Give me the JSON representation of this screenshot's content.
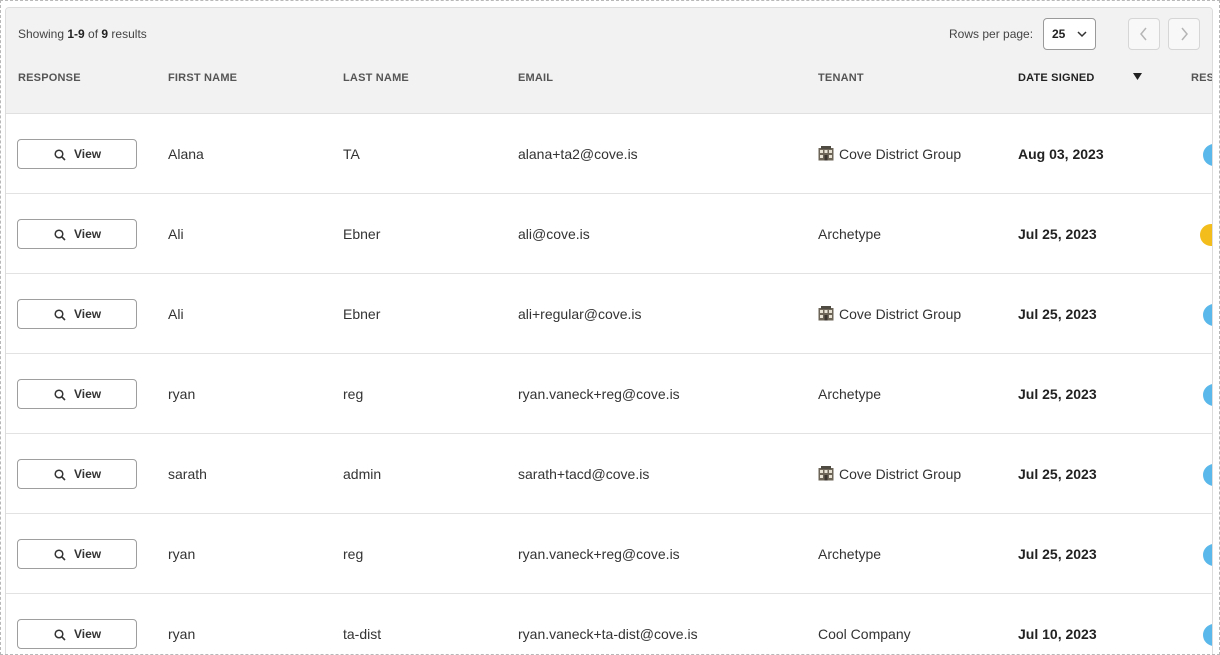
{
  "summary": {
    "prefix": "Showing ",
    "range": "1-9",
    "of_word": " of ",
    "total": "9",
    "suffix": " results"
  },
  "pagination": {
    "rows_per_page_label": "Rows per page:",
    "rows_per_page_value": "25"
  },
  "columns": {
    "response": "RESPONSE",
    "first_name": "FIRST NAME",
    "last_name": "LAST NAME",
    "email": "EMAIL",
    "tenant": "TENANT",
    "date_signed": "DATE SIGNED",
    "result_partial": "RES"
  },
  "view_label": "View",
  "rows": [
    {
      "first": "Alana",
      "last": "TA",
      "email": "alana+ta2@cove.is",
      "tenant": "Cove District Group",
      "tenant_icon": true,
      "date": "Aug 03, 2023",
      "status": "blue"
    },
    {
      "first": "Ali",
      "last": "Ebner",
      "email": "ali@cove.is",
      "tenant": "Archetype",
      "tenant_icon": false,
      "date": "Jul 25, 2023",
      "status": "yellow"
    },
    {
      "first": "Ali",
      "last": "Ebner",
      "email": "ali+regular@cove.is",
      "tenant": "Cove District Group",
      "tenant_icon": true,
      "date": "Jul 25, 2023",
      "status": "blue"
    },
    {
      "first": "ryan",
      "last": "reg",
      "email": "ryan.vaneck+reg@cove.is",
      "tenant": "Archetype",
      "tenant_icon": false,
      "date": "Jul 25, 2023",
      "status": "blue"
    },
    {
      "first": "sarath",
      "last": "admin",
      "email": "sarath+tacd@cove.is",
      "tenant": "Cove District Group",
      "tenant_icon": true,
      "date": "Jul 25, 2023",
      "status": "blue"
    },
    {
      "first": "ryan",
      "last": "reg",
      "email": "ryan.vaneck+reg@cove.is",
      "tenant": "Archetype",
      "tenant_icon": false,
      "date": "Jul 25, 2023",
      "status": "blue"
    },
    {
      "first": "ryan",
      "last": "ta-dist",
      "email": "ryan.vaneck+ta-dist@cove.is",
      "tenant": "Cool Company",
      "tenant_icon": false,
      "date": "Jul 10, 2023",
      "status": "blue"
    }
  ],
  "colors": {
    "blue": "#5bb8ea",
    "yellow": "#f3bd1b",
    "header_bg": "#f2f2f2"
  },
  "icons": {
    "search": "magnifier-icon",
    "tenant": "building-icon",
    "sort": "triangle-down-icon",
    "prev": "chevron-left-icon",
    "next": "chevron-right-icon",
    "select": "chevron-down-icon"
  }
}
